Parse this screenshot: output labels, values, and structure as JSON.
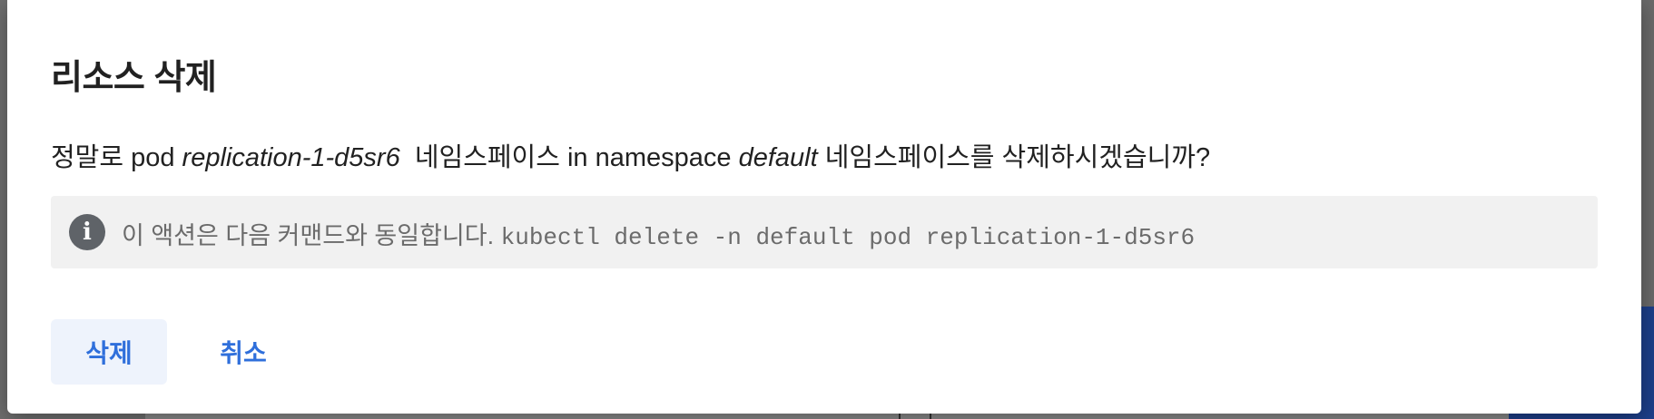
{
  "dialog": {
    "title": "리소스 삭제",
    "message": {
      "prefix": "정말로 pod ",
      "resource_name": "replication-1-d5sr6",
      "middle": "  네임스페이스 in namespace ",
      "namespace": "default",
      "suffix": " 네임스페이스를 삭제하시겠습니까?"
    },
    "info": {
      "icon": "info-icon",
      "icon_glyph": "i",
      "text": "이 액션은 다음 커맨드와 동일합니다. ",
      "command": "kubectl delete -n default pod replication-1-d5sr6"
    },
    "buttons": {
      "delete_label": "삭제",
      "cancel_label": "취소"
    }
  },
  "colors": {
    "accent": "#2f6fdb",
    "title": "#212121",
    "info_bg": "#f1f1f1",
    "info_icon_bg": "#5f6368",
    "info_text": "#6b6b6b"
  }
}
